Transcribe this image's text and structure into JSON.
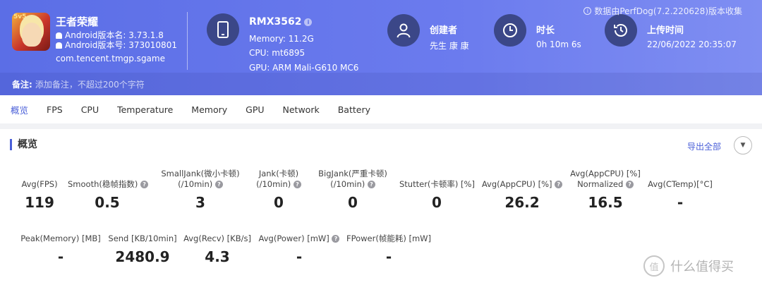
{
  "app": {
    "name": "王者荣耀",
    "version_label": "Android版本名: 3.73.1.8",
    "build_label": "Android版本号: 373010801",
    "package": "com.tencent.tmgp.sgame",
    "icon_badge": "5v5"
  },
  "device": {
    "model": "RMX3562",
    "memory": "Memory: 11.2G",
    "cpu": "CPU: mt6895",
    "gpu": "GPU: ARM Mali-G610 MC6"
  },
  "creator": {
    "label": "创建者",
    "value": "先生 康 康"
  },
  "duration": {
    "label": "时长",
    "value": "0h 10m 6s"
  },
  "upload": {
    "label": "上传时间",
    "value": "22/06/2022 20:35:07"
  },
  "collected_by": "数据由PerfDog(7.2.220628)版本收集",
  "note": {
    "label": "备注:",
    "placeholder": "添加备注，不超过200个字符"
  },
  "tabs": [
    "概览",
    "FPS",
    "CPU",
    "Temperature",
    "Memory",
    "GPU",
    "Network",
    "Battery"
  ],
  "overview": {
    "title": "概览",
    "export_label": "导出全部",
    "row1": [
      {
        "label1": "",
        "label2": "Avg(FPS)",
        "value": "119",
        "help": false
      },
      {
        "label1": "",
        "label2": "Smooth(稳帧指数)",
        "value": "0.5",
        "help": true
      },
      {
        "label1": "SmallJank(微小卡顿)",
        "label2": "(/10min)",
        "value": "3",
        "help": true
      },
      {
        "label1": "Jank(卡顿)",
        "label2": "(/10min)",
        "value": "0",
        "help": true
      },
      {
        "label1": "BigJank(严重卡顿)",
        "label2": "(/10min)",
        "value": "0",
        "help": true
      },
      {
        "label1": "",
        "label2": "Stutter(卡顿率) [%]",
        "value": "0",
        "help": false
      },
      {
        "label1": "",
        "label2": "Avg(AppCPU) [%]",
        "value": "26.2",
        "help": true
      },
      {
        "label1": "Avg(AppCPU) [%]",
        "label2": "Normalized",
        "value": "16.5",
        "help": true
      },
      {
        "label1": "",
        "label2": "Avg(CTemp)[°C]",
        "value": "-",
        "help": false
      }
    ],
    "row2": [
      {
        "label": "Peak(Memory) [MB]",
        "value": "-",
        "help": false
      },
      {
        "label": "Send [KB/10min]",
        "value": "2480.9",
        "help": false
      },
      {
        "label": "Avg(Recv) [KB/s]",
        "value": "4.3",
        "help": false
      },
      {
        "label": "Avg(Power) [mW]",
        "value": "-",
        "help": true
      },
      {
        "label": "FPower(帧能耗) [mW]",
        "value": "-",
        "help": false
      }
    ]
  },
  "watermark": "什么值得买"
}
